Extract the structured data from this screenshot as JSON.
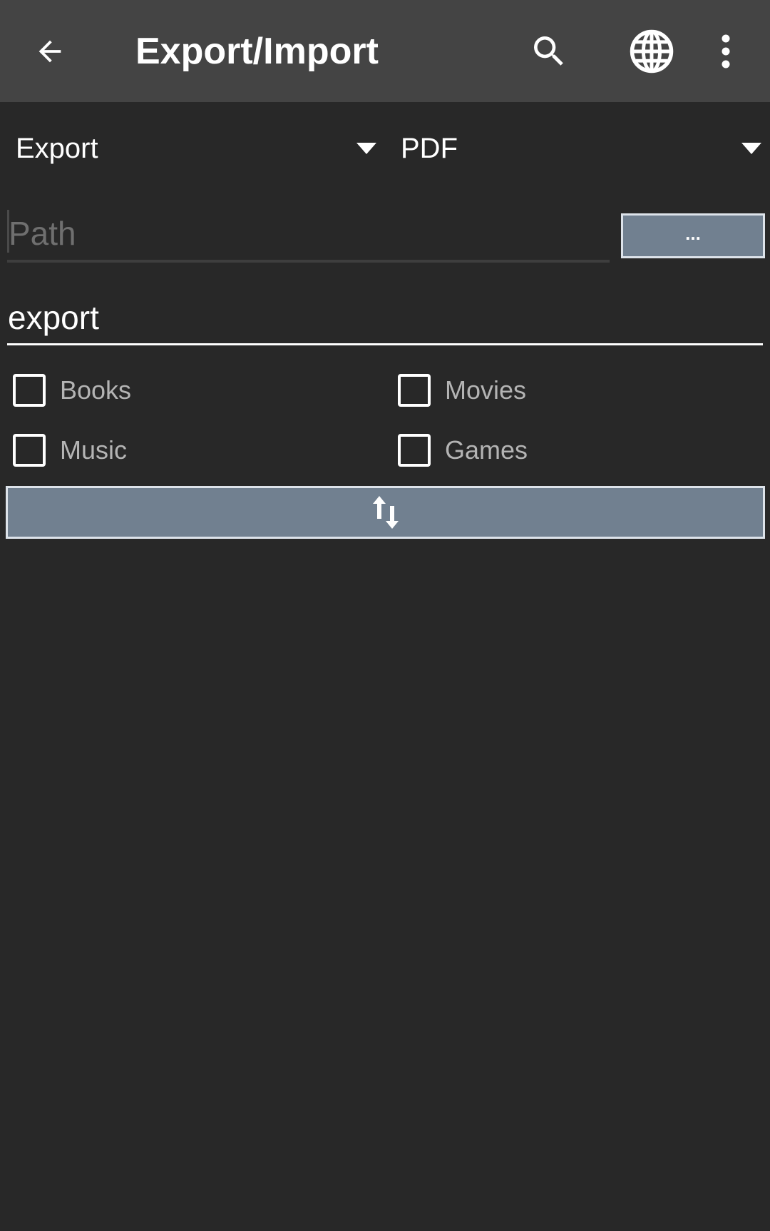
{
  "appbar": {
    "title": "Export/Import",
    "icons": [
      "arrow-back-icon",
      "search-icon",
      "globe-icon",
      "more-vert-icon"
    ]
  },
  "spinners": {
    "mode": {
      "value": "Export"
    },
    "format": {
      "value": "PDF"
    }
  },
  "path": {
    "placeholder": "Path",
    "value": "",
    "browse_label": "..."
  },
  "filename": {
    "value": "export"
  },
  "checkboxes": [
    {
      "label": "Books",
      "checked": false
    },
    {
      "label": "Movies",
      "checked": false
    },
    {
      "label": "Music",
      "checked": false
    },
    {
      "label": "Games",
      "checked": false
    }
  ],
  "action_button": {
    "icon": "swap-vertical-icon"
  },
  "colors": {
    "background": "#282828",
    "appbar": "#444444",
    "button": "#718090",
    "button_border": "#dde3ea"
  }
}
